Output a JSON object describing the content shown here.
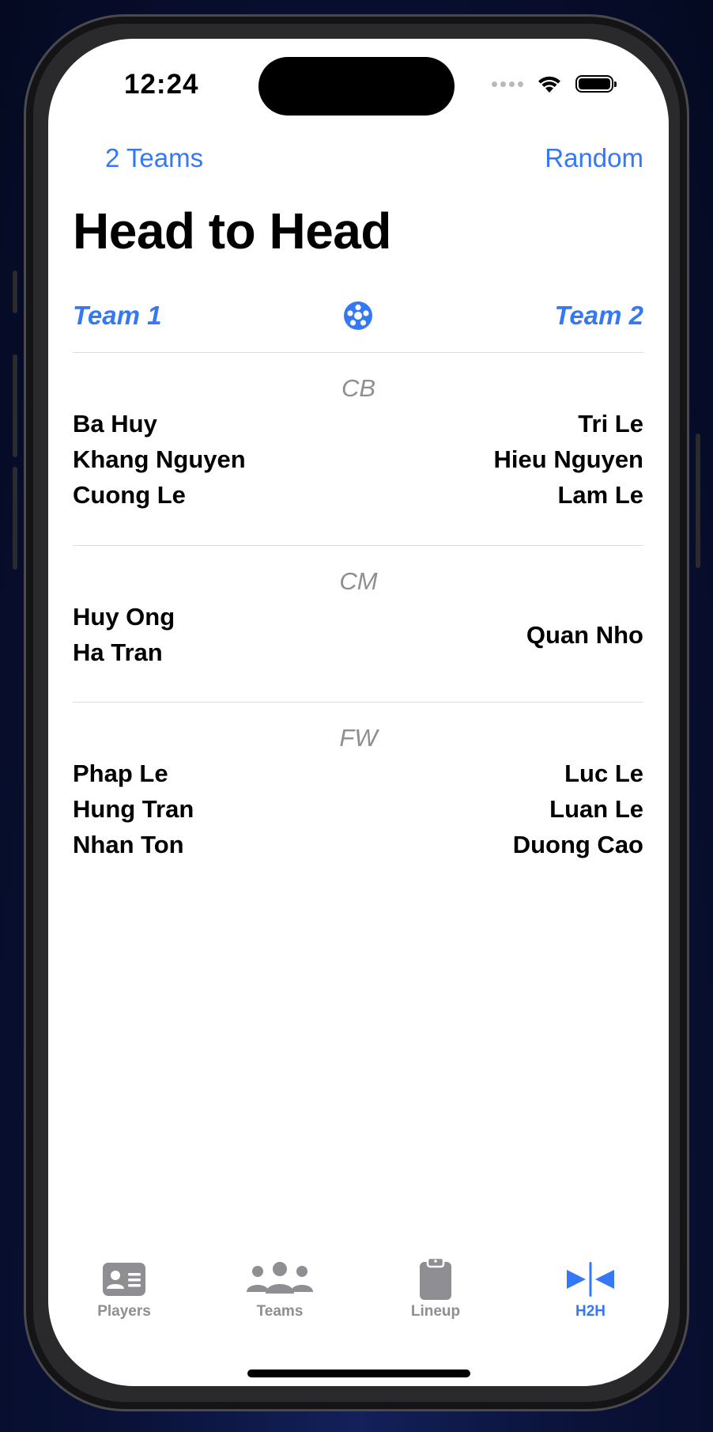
{
  "status_bar": {
    "time": "12:24"
  },
  "nav": {
    "left_label": "2 Teams",
    "right_label": "Random"
  },
  "page": {
    "title": "Head to Head"
  },
  "header": {
    "team1": "Team 1",
    "team2": "Team 2",
    "center_icon": "soccer-ball-icon"
  },
  "sections": [
    {
      "position": "CB",
      "team1": [
        "Ba Huy",
        "Khang Nguyen",
        "Cuong Le"
      ],
      "team2": [
        "Tri Le",
        "Hieu Nguyen",
        "Lam Le"
      ]
    },
    {
      "position": "CM",
      "team1": [
        "Huy Ong",
        "Ha Tran"
      ],
      "team2": [
        "Quan Nho"
      ]
    },
    {
      "position": "FW",
      "team1": [
        "Phap Le",
        "Hung Tran",
        "Nhan Ton"
      ],
      "team2": [
        "Luc Le",
        "Luan Le",
        "Duong Cao"
      ]
    }
  ],
  "tabs": [
    {
      "label": "Players",
      "icon": "person-card-icon",
      "active": false
    },
    {
      "label": "Teams",
      "icon": "people-group-icon",
      "active": false
    },
    {
      "label": "Lineup",
      "icon": "clipboard-icon",
      "active": false
    },
    {
      "label": "H2H",
      "icon": "head-to-head-icon",
      "active": true
    }
  ],
  "colors": {
    "accent": "#3478f6",
    "inactive": "#8e8e93",
    "section_label": "#8e8e93"
  }
}
